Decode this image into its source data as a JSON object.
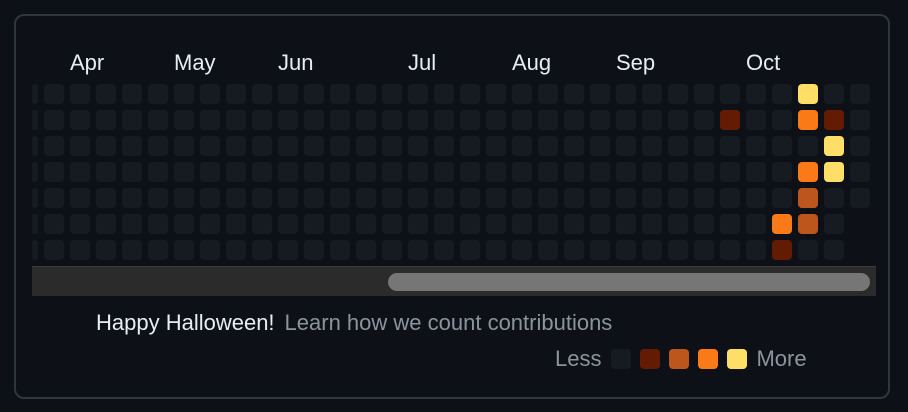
{
  "months": [
    "Apr",
    "May",
    "Jun",
    "Jul",
    "Aug",
    "Sep",
    "Oct"
  ],
  "colors": {
    "empty": "#161b22",
    "level1": "#631c03",
    "level2": "#bd561d",
    "level3": "#fa7a18",
    "level4": "#fddf68"
  },
  "weeks": 33,
  "days_per_week": 7,
  "contributions": [
    {
      "week": 27,
      "day": 1,
      "level": 1
    },
    {
      "week": 29,
      "day": 6,
      "level": 1
    },
    {
      "week": 30,
      "day": 0,
      "level": 4
    },
    {
      "week": 30,
      "day": 1,
      "level": 3
    },
    {
      "week": 30,
      "day": 3,
      "level": 3
    },
    {
      "week": 30,
      "day": 4,
      "level": 2
    },
    {
      "week": 30,
      "day": 5,
      "level": 2
    },
    {
      "week": 31,
      "day": 1,
      "level": 1
    },
    {
      "week": 31,
      "day": 2,
      "level": 4
    },
    {
      "week": 31,
      "day": 3,
      "level": 4
    },
    {
      "week": 29,
      "day": 5,
      "level": 3
    }
  ],
  "footer": {
    "message": "Happy Halloween!",
    "link": "Learn how we count contributions"
  },
  "legend": {
    "less": "Less",
    "more": "More"
  }
}
